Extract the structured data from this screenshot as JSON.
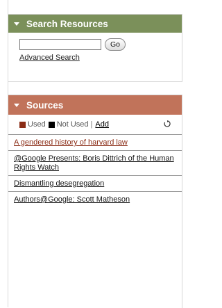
{
  "search_panel": {
    "title": "Search Resources",
    "input_value": "",
    "go_label": "Go",
    "advanced_label": "Advanced Search",
    "header_color": "#7b905a"
  },
  "sources_panel": {
    "title": "Sources",
    "header_color": "#c1735a",
    "legend": {
      "used_label": "Used",
      "not_used_label": "Not Used",
      "separator": "|",
      "add_label": "Add",
      "used_color": "#8b2d16",
      "not_used_color": "#000000"
    },
    "items": [
      {
        "label": "A gendered history of harvard law",
        "status": "used"
      },
      {
        "label": "@Google Presents: Boris Dittrich of the Human Rights Watch",
        "status": "not-used"
      },
      {
        "label": "Dismantling desegregation",
        "status": "not-used"
      },
      {
        "label": "Authors@Google: Scott Matheson",
        "status": "not-used"
      }
    ]
  }
}
